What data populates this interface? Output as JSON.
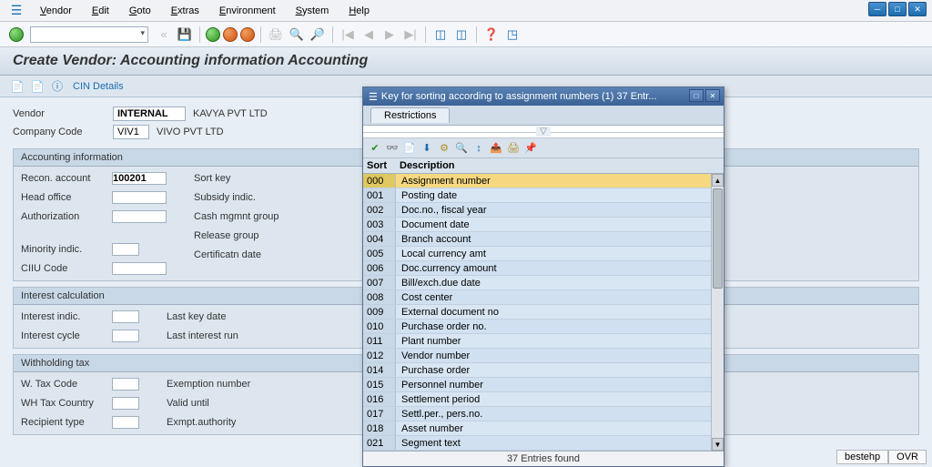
{
  "menu": {
    "items": [
      "Vendor",
      "Edit",
      "Goto",
      "Extras",
      "Environment",
      "System",
      "Help"
    ]
  },
  "page": {
    "title": "Create Vendor: Accounting information Accounting",
    "cin_details": "CIN Details"
  },
  "header": {
    "vendor_label": "Vendor",
    "vendor_value": "INTERNAL",
    "vendor_name": "KAVYA PVT LTD",
    "company_code_label": "Company Code",
    "company_code_value": "VIV1",
    "company_name": "VIVO PVT LTD"
  },
  "sections": {
    "accounting": {
      "title": "Accounting information",
      "left": [
        {
          "label": "Recon. account",
          "value": "100201"
        },
        {
          "label": "Head office",
          "value": ""
        },
        {
          "label": "Authorization",
          "value": ""
        },
        {
          "label": "",
          "value": null
        },
        {
          "label": "Minority indic.",
          "value": ""
        },
        {
          "label": "CIIU Code",
          "value": ""
        }
      ],
      "right": [
        {
          "label": "Sort key"
        },
        {
          "label": "Subsidy indic."
        },
        {
          "label": "Cash mgmnt group"
        },
        {
          "label": "Release group"
        },
        {
          "label": "Certificatn date"
        }
      ]
    },
    "interest": {
      "title": "Interest calculation",
      "left": [
        {
          "label": "Interest indic."
        },
        {
          "label": "Interest cycle"
        }
      ],
      "right": [
        {
          "label": "Last key date"
        },
        {
          "label": "Last interest run"
        }
      ]
    },
    "withholding": {
      "title": "Withholding tax",
      "left": [
        {
          "label": "W. Tax Code"
        },
        {
          "label": "WH Tax Country"
        },
        {
          "label": "Recipient type"
        }
      ],
      "right": [
        {
          "label": "Exemption number"
        },
        {
          "label": "Valid  until"
        },
        {
          "label": "Exmpt.authority"
        }
      ]
    }
  },
  "popup": {
    "title": "Key for sorting according to assignment numbers (1)   37 Entr...",
    "tab": "Restrictions",
    "col_sort": "Sort",
    "col_desc": "Description",
    "rows": [
      {
        "sort": "000",
        "desc": "Assignment number",
        "selected": true
      },
      {
        "sort": "001",
        "desc": "Posting date"
      },
      {
        "sort": "002",
        "desc": "Doc.no., fiscal year"
      },
      {
        "sort": "003",
        "desc": "Document date"
      },
      {
        "sort": "004",
        "desc": "Branch account"
      },
      {
        "sort": "005",
        "desc": "Local currency amt"
      },
      {
        "sort": "006",
        "desc": "Doc.currency amount"
      },
      {
        "sort": "007",
        "desc": "Bill/exch.due date"
      },
      {
        "sort": "008",
        "desc": "Cost center"
      },
      {
        "sort": "009",
        "desc": "External document no"
      },
      {
        "sort": "010",
        "desc": "Purchase order no."
      },
      {
        "sort": "011",
        "desc": "Plant number"
      },
      {
        "sort": "012",
        "desc": "Vendor number"
      },
      {
        "sort": "014",
        "desc": "Purchase order"
      },
      {
        "sort": "015",
        "desc": "Personnel number"
      },
      {
        "sort": "016",
        "desc": "Settlement period"
      },
      {
        "sort": "017",
        "desc": "Settl.per., pers.no."
      },
      {
        "sort": "018",
        "desc": "Asset number"
      },
      {
        "sort": "021",
        "desc": "Segment text"
      }
    ],
    "status": "37 Entries found"
  },
  "statusbar": {
    "user": "bestehp",
    "mode": "OVR"
  }
}
